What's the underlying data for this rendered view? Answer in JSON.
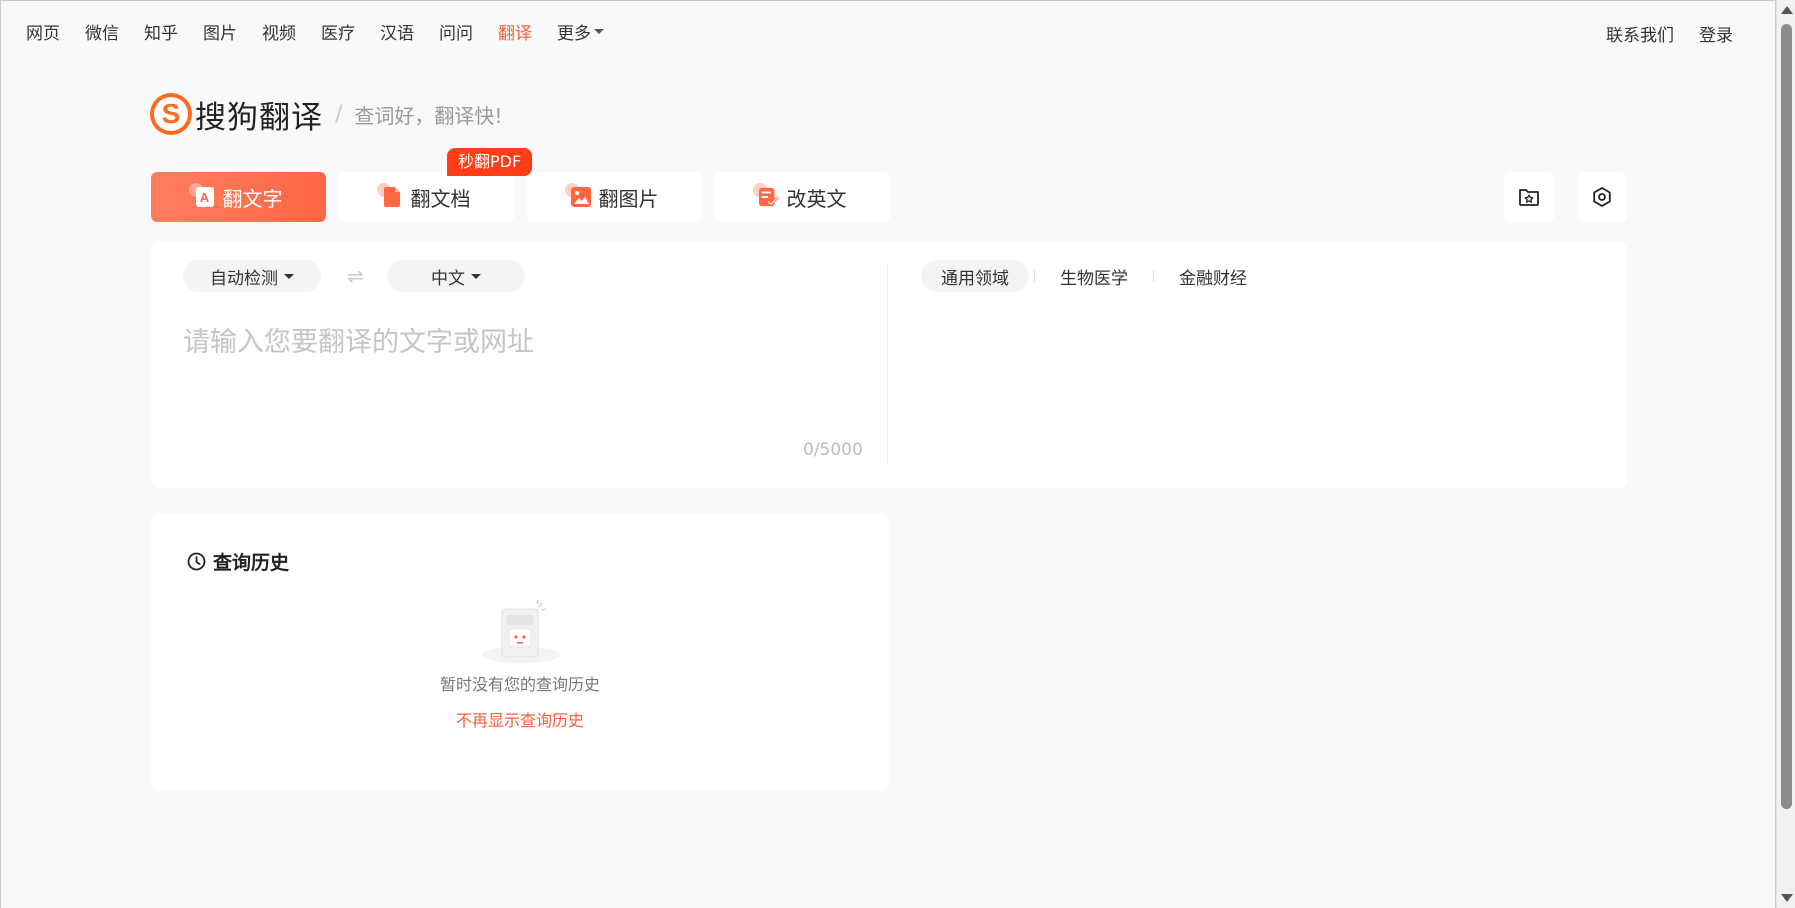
{
  "topnav": {
    "items": [
      "网页",
      "微信",
      "知乎",
      "图片",
      "视频",
      "医疗",
      "汉语",
      "问问",
      "翻译"
    ],
    "more_label": "更多",
    "active": "翻译"
  },
  "topright": {
    "contact": "联系我们",
    "login": "登录"
  },
  "brand": {
    "logo_letter": "S",
    "name": "搜狗翻译",
    "slash": "/",
    "slogan": "查词好，翻译快!"
  },
  "tabs": [
    {
      "label": "翻文字",
      "icon": "text-translate-icon",
      "glyph": "A"
    },
    {
      "label": "翻文档",
      "icon": "document-icon",
      "glyph": ""
    },
    {
      "label": "翻图片",
      "icon": "image-icon",
      "glyph": ""
    },
    {
      "label": "改英文",
      "icon": "edit-english-icon",
      "glyph": ""
    }
  ],
  "pdf_badge": "秒翻PDF",
  "translator": {
    "source_lang": "自动检测",
    "swap_glyph": "⇌",
    "target_lang": "中文",
    "placeholder": "请输入您要翻译的文字或网址",
    "counter": "0/5000",
    "domains": [
      "通用领域",
      "生物医学",
      "金融财经"
    ]
  },
  "history": {
    "title": "查询历史",
    "empty_text": "暂时没有您的查询历史",
    "hide_link": "不再显示查询历史"
  },
  "colors": {
    "accent": "#ff5c38",
    "tab_gradient_start": "#ff7e5f",
    "tab_gradient_end": "#ff6745",
    "badge": "#ff3d17",
    "logo": "#ff6a1f"
  }
}
